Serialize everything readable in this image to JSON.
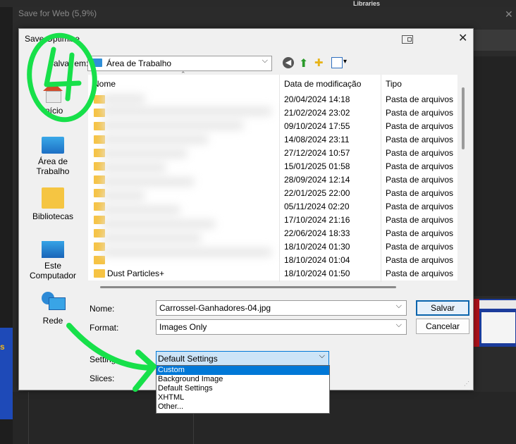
{
  "bg": {
    "window_title": "Save for Web (5,9%)",
    "libraries_label": "Libraries",
    "close_glyph": "✕",
    "side_text": "s"
  },
  "dialog": {
    "title": "Save Optimize",
    "close_glyph": "✕",
    "save_in_label": "Salvar em:",
    "save_in_value": "Área de Trabalho",
    "chevron": "⌵",
    "toolbar": {
      "back_glyph": "◀",
      "up_glyph": "⬆",
      "new_folder_glyph": "✚",
      "view_chevron": "▾"
    }
  },
  "places": [
    {
      "label": "Início",
      "icon": "home-icon"
    },
    {
      "label": "Área de Trabalho",
      "icon": "desktop-icon"
    },
    {
      "label": "Bibliotecas",
      "icon": "libraries-icon"
    },
    {
      "label": "Este Computador",
      "icon": "computer-icon"
    },
    {
      "label": "Rede",
      "icon": "network-icon"
    }
  ],
  "columns": {
    "name": "Nome",
    "date": "Data de modificação",
    "type": "Tipo"
  },
  "rows": [
    {
      "name": "",
      "date": "20/04/2024 14:18",
      "type": "Pasta de arquivos"
    },
    {
      "name": "",
      "date": "21/02/2024 23:02",
      "type": "Pasta de arquivos"
    },
    {
      "name": "",
      "date": "09/10/2024 17:55",
      "type": "Pasta de arquivos"
    },
    {
      "name": "",
      "date": "14/08/2024 23:11",
      "type": "Pasta de arquivos"
    },
    {
      "name": "",
      "date": "27/12/2024 10:57",
      "type": "Pasta de arquivos"
    },
    {
      "name": "",
      "date": "15/01/2025 01:58",
      "type": "Pasta de arquivos"
    },
    {
      "name": "",
      "date": "28/09/2024 12:14",
      "type": "Pasta de arquivos"
    },
    {
      "name": "",
      "date": "22/01/2025 22:00",
      "type": "Pasta de arquivos"
    },
    {
      "name": "",
      "date": "05/11/2024 02:20",
      "type": "Pasta de arquivos"
    },
    {
      "name": "",
      "date": "17/10/2024 21:16",
      "type": "Pasta de arquivos"
    },
    {
      "name": "",
      "date": "22/06/2024 18:33",
      "type": "Pasta de arquivos"
    },
    {
      "name": "",
      "date": "18/10/2024 01:30",
      "type": "Pasta de arquivos"
    },
    {
      "name": "",
      "date": "18/10/2024 01:04",
      "type": "Pasta de arquivos"
    },
    {
      "name": "Dust Particles+",
      "date": "18/10/2024 01:50",
      "type": "Pasta de arquivos"
    }
  ],
  "form": {
    "name_label": "Nome:",
    "name_value": "Carrossel-Ganhadores-04.jpg",
    "format_label": "Format:",
    "format_value": "Images Only",
    "settings_label": "Setting",
    "settings_value": "Default Settings",
    "slices_label": "Slices:",
    "save_button": "Salvar",
    "cancel_button": "Cancelar",
    "settings_options": [
      "Custom",
      "Background Image",
      "Default Settings",
      "XHTML",
      "Other..."
    ]
  },
  "colors": {
    "annotation": "#17e04a",
    "selection": "#0078d7",
    "folder": "#f6c343"
  }
}
